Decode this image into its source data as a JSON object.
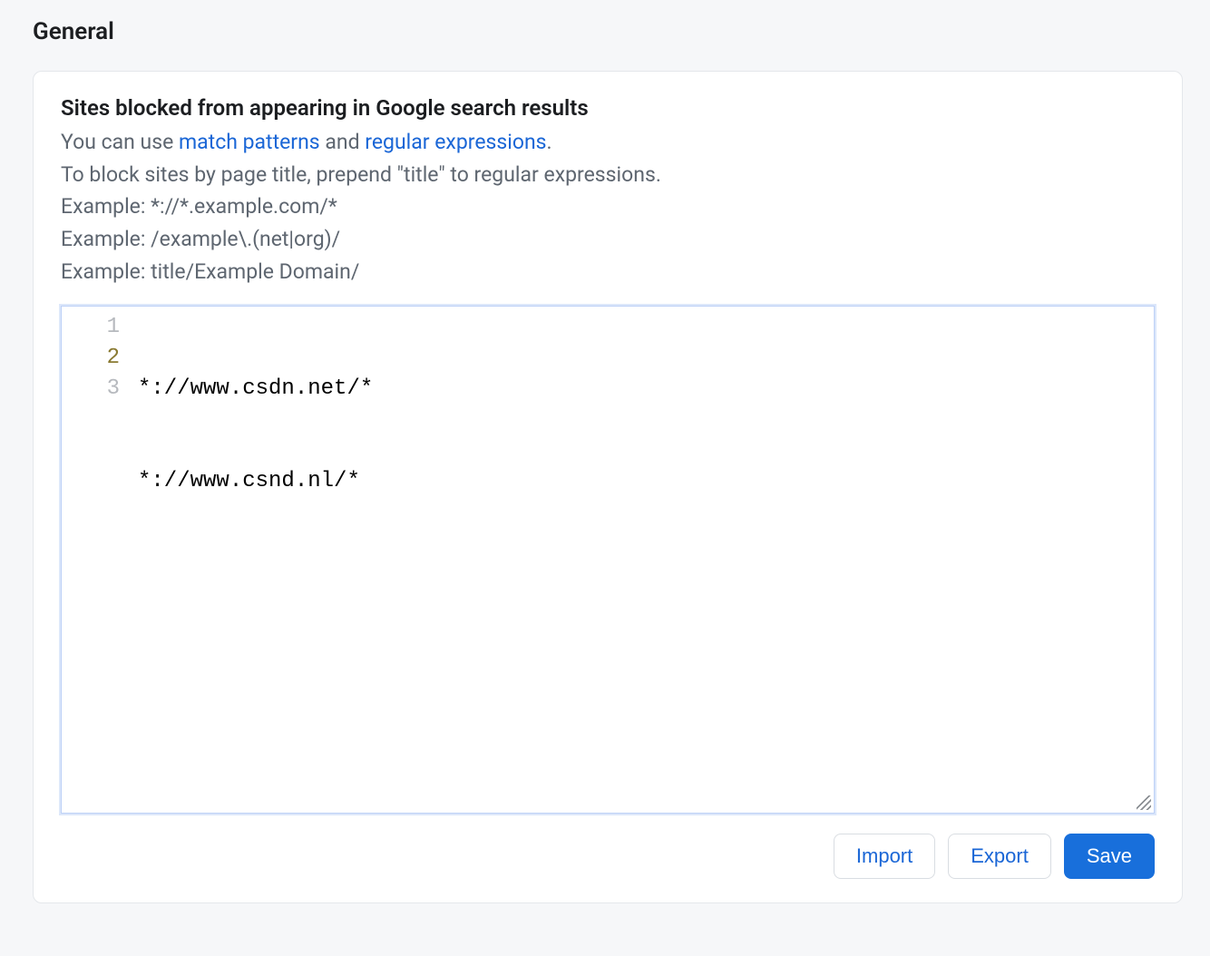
{
  "heading": "General",
  "section": {
    "title": "Sites blocked from appearing in Google search results",
    "help_line1_pre": "You can use ",
    "help_line1_link1": "match patterns",
    "help_line1_mid": " and ",
    "help_line1_link2": "regular expressions",
    "help_line1_post": ".",
    "help_line2": "To block sites by page title, prepend \"title\" to regular expressions.",
    "help_example1": "Example: *://*.example.com/*",
    "help_example2": "Example: /example\\.(net|org)/",
    "help_example3": "Example: title/Example Domain/"
  },
  "editor": {
    "lines": [
      "*://www.csdn.net/*",
      "*://www.csnd.nl/*",
      ""
    ],
    "gutter": [
      "1",
      "2",
      "3"
    ],
    "current_line_index": 1
  },
  "buttons": {
    "import": "Import",
    "export": "Export",
    "save": "Save"
  }
}
